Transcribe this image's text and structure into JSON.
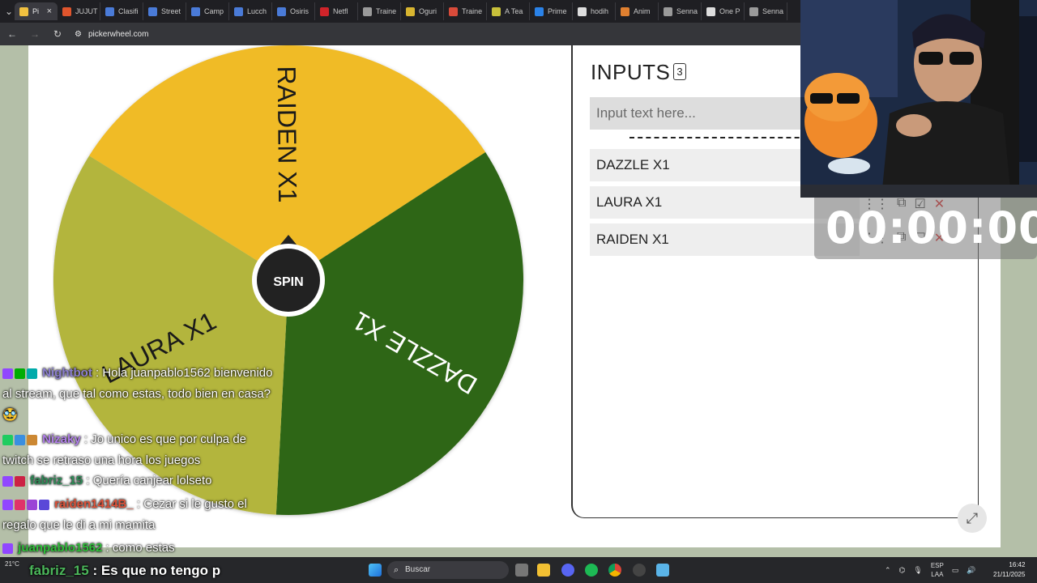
{
  "browser": {
    "tabs": [
      {
        "title": "Pi",
        "color": "#f0c040",
        "active": true
      },
      {
        "title": "JUJUT",
        "color": "#e0552d"
      },
      {
        "title": "Clasifi",
        "color": "#4a7bd8"
      },
      {
        "title": "Street",
        "color": "#4a7bd8"
      },
      {
        "title": "Camp",
        "color": "#4a7bd8"
      },
      {
        "title": "Lucch",
        "color": "#4a7bd8"
      },
      {
        "title": "Osiris",
        "color": "#4a7bd8"
      },
      {
        "title": "Netfl",
        "color": "#d0242a"
      },
      {
        "title": "Traine",
        "color": "#9a9a9a"
      },
      {
        "title": "Oguri",
        "color": "#d8b530"
      },
      {
        "title": "Traine",
        "color": "#d94b3a"
      },
      {
        "title": "A Tea",
        "color": "#c8c03a"
      },
      {
        "title": "Prime",
        "color": "#2a82e8"
      },
      {
        "title": "hodih",
        "color": "#dddddd"
      },
      {
        "title": "Anim",
        "color": "#e08030"
      },
      {
        "title": "Senna",
        "color": "#9a9a9a"
      },
      {
        "title": "One P",
        "color": "#dddddd"
      },
      {
        "title": "Senna",
        "color": "#9a9a9a"
      }
    ],
    "url": "pickerwheel.com"
  },
  "wheel": {
    "center_label": "SPIN",
    "segments": [
      {
        "label": "RAIDEN X1",
        "color": "#f0bb25"
      },
      {
        "label": "DAZZLE X1",
        "color": "#2e6614"
      },
      {
        "label": "LAURA X1",
        "color": "#b3b53c"
      }
    ]
  },
  "inputs": {
    "title": "INPUTS",
    "count": "3",
    "placeholder": "Input text here...",
    "entries": [
      "DAZZLE X1",
      "LAURA X1",
      "RAIDEN X1"
    ]
  },
  "timer": "00:00:00",
  "chat": [
    {
      "user": "Nightbot",
      "color": "#8c7fd0",
      "badges": [
        "#9147ff",
        "#00ad03",
        "#0aa"
      ],
      "text": "Hola juanpablo1562 bienvenido al stream, que tal como estas, todo bien en casa? 🥸"
    },
    {
      "user": "Nizaky",
      "color": "#b07fe8",
      "badges": [
        "#1fcc60",
        "#3a8fe0",
        "#cc8833"
      ],
      "text": "Jo unico es que por culpa de twitch se retraso una hora los juegos"
    },
    {
      "user": "fabriz_15",
      "color": "#2e8b57",
      "badges": [
        "#9147ff",
        "#cc2244"
      ],
      "text": "Quería canjear lolseto"
    },
    {
      "user": "raiden1414B_",
      "color": "#e0533a",
      "badges": [
        "#9147ff",
        "#e0336a",
        "#9b44d6",
        "#5a48d8"
      ],
      "text": "Cezar si le gusto el regalo que le di a mi mamita"
    },
    {
      "user": "juanpablo1562",
      "color": "#2fbf3a",
      "badges": [
        "#9147ff"
      ],
      "text": "como estas"
    }
  ],
  "chat_bottom": {
    "user": "fabriz_15",
    "text": "Es que no tengo p"
  },
  "taskbar": {
    "search_label": "Buscar",
    "lang_top": "ESP",
    "lang_bottom": "LAA",
    "time": "16:42",
    "date": "21/11/2025",
    "weather": "21°C"
  }
}
